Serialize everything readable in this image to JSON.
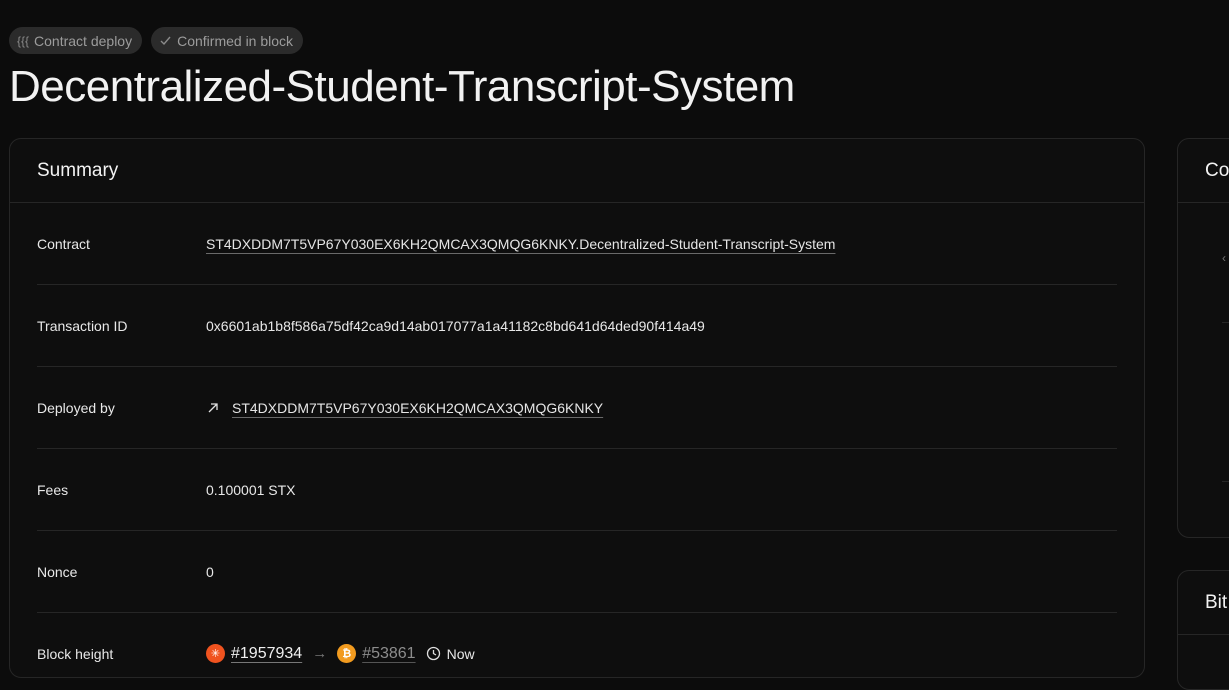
{
  "badges": {
    "deploy": "Contract deploy",
    "confirmed": "Confirmed in block"
  },
  "title": "Decentralized-Student-Transcript-System",
  "summary": {
    "heading": "Summary",
    "rows": {
      "contract": {
        "label": "Contract",
        "value": "ST4DXDDM7T5VP67Y030EX6KH2QMCAX3QMQG6KNKY.Decentralized-Student-Transcript-System"
      },
      "txid": {
        "label": "Transaction ID",
        "value": "0x6601ab1b8f586a75df42ca9d14ab017077a1a41182c8bd641d64ded90f414a49"
      },
      "deployer": {
        "label": "Deployed by",
        "value": "ST4DXDDM7T5VP67Y030EX6KH2QMCAX3QMQG6KNKY"
      },
      "fees": {
        "label": "Fees",
        "value": "0.100001 STX"
      },
      "nonce": {
        "label": "Nonce",
        "value": "0"
      },
      "block": {
        "label": "Block height",
        "stacks_block": "#1957934",
        "bitcoin_block": "#53861",
        "time": "Now"
      }
    }
  },
  "side_cards": {
    "first_header": "Co",
    "second_header": "Bit"
  },
  "colors": {
    "background": "#0c0c0c",
    "stacks_orange": "#f0531f",
    "bitcoin_orange": "#f29b1f"
  }
}
